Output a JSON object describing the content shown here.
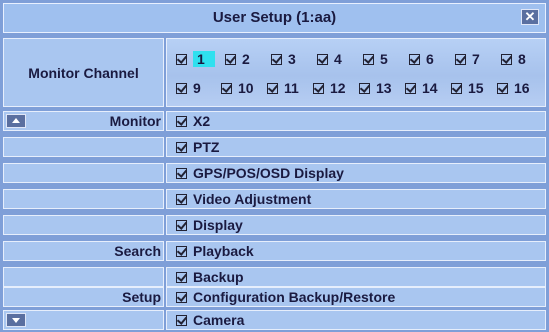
{
  "window": {
    "title": "User Setup (1:aa)",
    "close_label": "✕"
  },
  "monitor_channel": {
    "label": "Monitor Channel",
    "selected": "1",
    "channels": [
      "1",
      "2",
      "3",
      "4",
      "5",
      "6",
      "7",
      "8",
      "9",
      "10",
      "11",
      "12",
      "13",
      "14",
      "15",
      "16"
    ],
    "checked": true
  },
  "permissions": [
    {
      "section": "Monitor",
      "item": "X2",
      "checked": true,
      "scroll": "up"
    },
    {
      "section": "",
      "item": "PTZ",
      "checked": true
    },
    {
      "section": "",
      "item": "GPS/POS/OSD Display",
      "checked": true
    },
    {
      "section": "",
      "item": "Video Adjustment",
      "checked": true
    },
    {
      "section": "",
      "item": "Display",
      "checked": true
    },
    {
      "section": "Search",
      "item": "Playback",
      "checked": true
    },
    {
      "section": "",
      "item": "Backup",
      "checked": true
    },
    {
      "section": "Setup",
      "item": "Configuration Backup/Restore",
      "checked": true
    },
    {
      "section": "",
      "item": "Camera",
      "checked": true,
      "scroll": "down"
    }
  ],
  "colors": {
    "background": "#7f9fd8",
    "cell": "#a9c6f0",
    "selected_highlight": "#2fe0ef",
    "text": "#1a1a40"
  },
  "icons": {
    "close": "close-icon",
    "scroll_up": "scroll-up-icon",
    "scroll_down": "scroll-down-icon",
    "checkbox": "checkbox-checked-icon"
  }
}
